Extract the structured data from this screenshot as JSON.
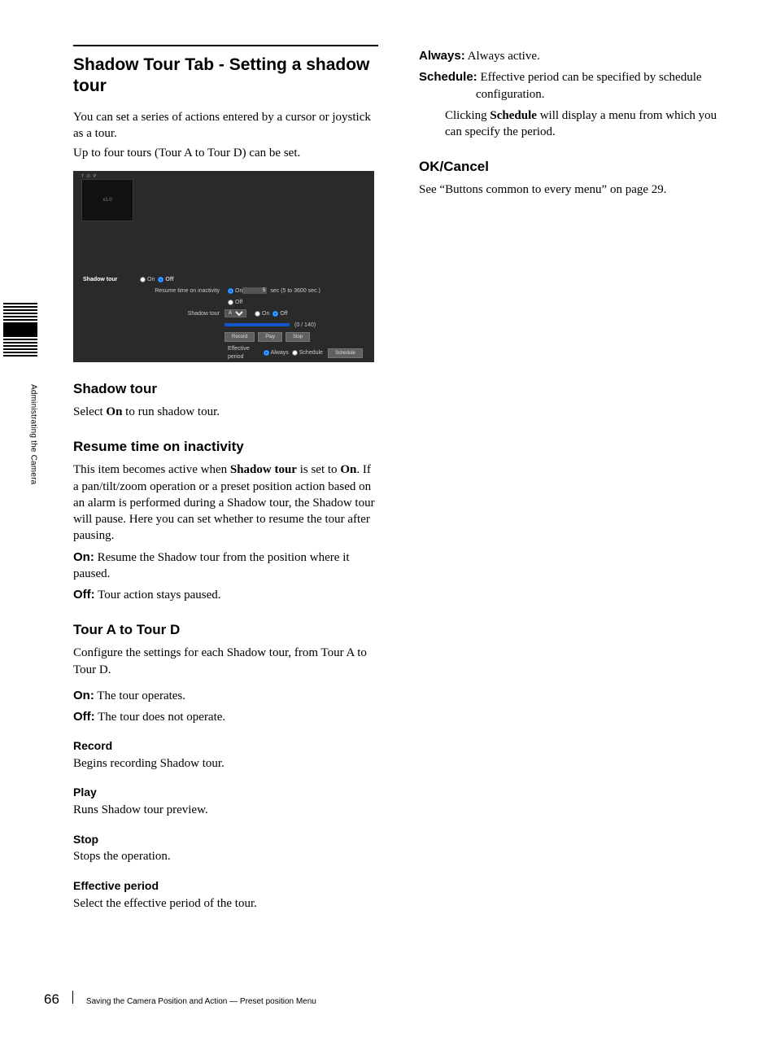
{
  "sidebar": {
    "label": "Administrating the Camera"
  },
  "col1": {
    "heading": "Shadow Tour Tab - Setting a shadow tour",
    "intro1": "You can set a series of actions entered by a cursor or joystick as a tour.",
    "intro2": "Up to four tours (Tour A to Tour D) can be set.",
    "s_shadowtour_h": "Shadow tour",
    "s_shadowtour_p1a": "Select ",
    "s_shadowtour_p1b": "On",
    "s_shadowtour_p1c": " to run shadow tour.",
    "s_resume_h": "Resume time on inactivity",
    "s_resume_p1a": "This item becomes active when ",
    "s_resume_p1b": "Shadow tour",
    "s_resume_p1c": " is set to ",
    "s_resume_p1d": "On",
    "s_resume_p1e": ". If a pan/tilt/zoom operation or a preset position action based on an alarm is performed during a Shadow tour, the Shadow tour will pause. Here you can set whether to resume the tour after pausing.",
    "s_resume_on_l": "On:",
    "s_resume_on_t": "Resume the Shadow tour from the position where it paused.",
    "s_resume_off_l": "Off:",
    "s_resume_off_t": " Tour action stays paused.",
    "s_tourad_h": "Tour A to Tour D",
    "s_tourad_p1": "Configure the settings for each Shadow tour, from Tour A to Tour D.",
    "s_tourad_on_l": "On:",
    "s_tourad_on_t": " The tour operates.",
    "s_tourad_off_l": "Off:",
    "s_tourad_off_t": " The tour does not operate.",
    "s_record_h": "Record",
    "s_record_p": "Begins recording Shadow tour.",
    "s_play_h": "Play",
    "s_play_p": "Runs Shadow tour preview.",
    "s_stop_h": "Stop",
    "s_stop_p": "Stops the operation.",
    "s_eff_h": "Effective period",
    "s_eff_p": "Select the effective period of the tour."
  },
  "col2": {
    "always_l": "Always:",
    "always_t": " Always active.",
    "sched_l": "Schedule:",
    "sched_t": " Effective period can be specified by schedule configuration.",
    "sched_p2a": "Clicking ",
    "sched_p2b": "Schedule",
    "sched_p2c": " will display a menu from which you can specify the period.",
    "okcancel_h": "OK/Cancel",
    "okcancel_p": "See “Buttons common to every menu” on page 29."
  },
  "panel": {
    "preview_text": "x1.0",
    "tab1": "T",
    "tab2": "D",
    "tab3": "P",
    "lbl_shadowtour": "Shadow tour",
    "on": "On",
    "off": "Off",
    "lbl_resume": "Resume time on inactivity",
    "resume_val": "5",
    "resume_unit": "sec (5 to 3600 sec.)",
    "lbl_tour": "Shadow tour",
    "tour_select": "A",
    "progress_txt": "(0 / 140)",
    "btn_record": "Record",
    "btn_play": "Play",
    "btn_stop": "Stop",
    "lbl_effperiod": "Effective period",
    "eff_always": "Always",
    "eff_schedule": "Schedule",
    "eff_schedule_btn": "Schedule"
  },
  "footer": {
    "page": "66",
    "text": "Saving the Camera Position and Action — Preset position Menu"
  }
}
